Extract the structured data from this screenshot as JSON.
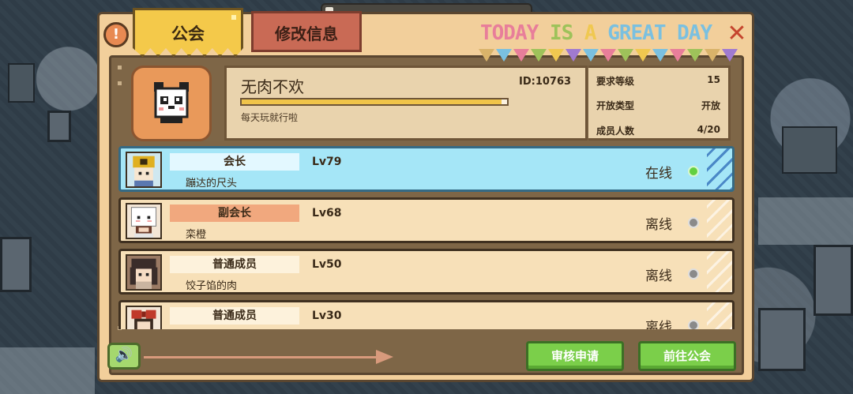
{
  "tabs": {
    "guild": "公会",
    "edit_info": "修改信息",
    "help_icon": "!",
    "close_icon": "✕"
  },
  "banner": {
    "words": [
      "TODAY",
      "IS",
      "A",
      "GREAT DAY"
    ],
    "flag_colors": [
      "#d9b36a",
      "#7ac0e0",
      "#e87e9a",
      "#9ec25a",
      "#f0c850",
      "#a07ad0",
      "#7ac0e0",
      "#e87e9a",
      "#9ec25a",
      "#f0c850",
      "#7ac0e0",
      "#e87e9a",
      "#9ec25a",
      "#d9b36a",
      "#a07ad0"
    ]
  },
  "guild": {
    "name": "无肉不欢",
    "id": "ID:10763",
    "progress": 0.98,
    "motto": "每天玩就行啦",
    "stats": [
      {
        "label": "要求等级",
        "value": "15"
      },
      {
        "label": "开放类型",
        "value": "开放"
      },
      {
        "label": "成员人数",
        "value": "4/20"
      }
    ]
  },
  "members": [
    {
      "role": "会长",
      "level": "Lv79",
      "name": "蹦达的尺头",
      "status": "在线",
      "online": true
    },
    {
      "role": "副会长",
      "level": "Lv68",
      "name": "栾橙",
      "status": "离线",
      "online": false
    },
    {
      "role": "普通成员",
      "level": "Lv50",
      "name": "饺子馅的肉",
      "status": "离线",
      "online": false
    },
    {
      "role": "普通成员",
      "level": "Lv30",
      "name": "",
      "status": "离线",
      "online": false
    }
  ],
  "footer": {
    "voice_icon": "🔊",
    "review_button": "审核申请",
    "go_guild_button": "前往公会"
  }
}
